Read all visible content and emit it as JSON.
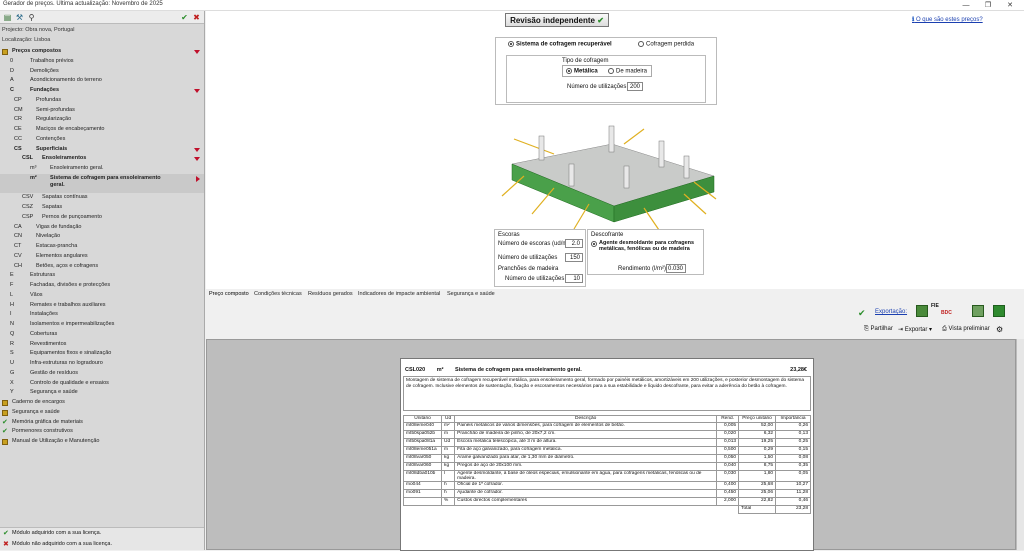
{
  "window": {
    "title": "Gerador de preços. Última actualização: Novembro de 2025",
    "min": "—",
    "max": "❐",
    "close": "✕"
  },
  "project": {
    "line1": "Projecto: Obra nova, Portugal",
    "line2": "Localização: Lisboa"
  },
  "tree": [
    {
      "code": "",
      "label": "Preços compostos",
      "bold": true,
      "indent": 0,
      "marker": "down",
      "dot": true
    },
    {
      "code": "0",
      "label": "Trabalhos prévios",
      "indent": 1
    },
    {
      "code": "D",
      "label": "Demolições",
      "indent": 1
    },
    {
      "code": "A",
      "label": "Acondicionamento do terreno",
      "indent": 1
    },
    {
      "code": "C",
      "label": "Fundações",
      "bold": true,
      "indent": 1,
      "marker": "down"
    },
    {
      "code": "CP",
      "label": "Profundas",
      "indent": 2
    },
    {
      "code": "CM",
      "label": "Semi-profundas",
      "indent": 2
    },
    {
      "code": "CR",
      "label": "Regularização",
      "indent": 2
    },
    {
      "code": "CE",
      "label": "Maciços de encabeçamento",
      "indent": 2
    },
    {
      "code": "CC",
      "label": "Contenções",
      "indent": 2
    },
    {
      "code": "CS",
      "label": "Superficiais",
      "bold": true,
      "indent": 2,
      "marker": "down"
    },
    {
      "code": "CSL",
      "label": "Ensoleiramentos",
      "bold": true,
      "indent": 3,
      "marker": "down"
    },
    {
      "code": "m³",
      "label": "Ensoleiramento geral.",
      "indent": 4
    },
    {
      "code": "m²",
      "label": "Sistema de cofragem para ensoleiramento geral.",
      "bold": true,
      "indent": 4,
      "marker": "right",
      "sel": true,
      "twoline": true
    },
    {
      "code": "CSV",
      "label": "Sapatas contínuas",
      "indent": 3
    },
    {
      "code": "CSZ",
      "label": "Sapatas",
      "indent": 3
    },
    {
      "code": "CSP",
      "label": "Pernos de punçoamento",
      "indent": 3
    },
    {
      "code": "CA",
      "label": "Vigas de fundação",
      "indent": 2
    },
    {
      "code": "CN",
      "label": "Nivelação",
      "indent": 2
    },
    {
      "code": "CT",
      "label": "Estacas-prancha",
      "indent": 2
    },
    {
      "code": "CV",
      "label": "Elementos angulares",
      "indent": 2
    },
    {
      "code": "CH",
      "label": "Betões, aços e cofragens",
      "indent": 2
    },
    {
      "code": "E",
      "label": "Estruturas",
      "indent": 1
    },
    {
      "code": "F",
      "label": "Fachadas, divisões e protecções",
      "indent": 1
    },
    {
      "code": "L",
      "label": "Vãos",
      "indent": 1
    },
    {
      "code": "H",
      "label": "Remates e trabalhos auxiliares",
      "indent": 1
    },
    {
      "code": "I",
      "label": "Instalações",
      "indent": 1
    },
    {
      "code": "N",
      "label": "Isolamentos e impermeabilizações",
      "indent": 1
    },
    {
      "code": "Q",
      "label": "Coberturas",
      "indent": 1
    },
    {
      "code": "R",
      "label": "Revestimentos",
      "indent": 1
    },
    {
      "code": "S",
      "label": "Equipamentos fixos e sinalização",
      "indent": 1
    },
    {
      "code": "U",
      "label": "Infra-estruturas no logradouro",
      "indent": 1
    },
    {
      "code": "G",
      "label": "Gestão de resíduos",
      "indent": 1
    },
    {
      "code": "X",
      "label": "Controlo de qualidade e ensaios",
      "indent": 1
    },
    {
      "code": "Y",
      "label": "Segurança e saúde",
      "indent": 1
    },
    {
      "code": "",
      "label": "Caderno de encargos",
      "indent": 0,
      "dot": true
    },
    {
      "code": "",
      "label": "Segurança e saúde",
      "indent": 0,
      "dot": true
    },
    {
      "code": "",
      "label": "Memória gráfica de materiais",
      "indent": 0,
      "check": true
    },
    {
      "code": "",
      "label": "Pormenores construtivos",
      "indent": 0,
      "check": true
    },
    {
      "code": "",
      "label": "Manual de Utilização e Manutenção",
      "indent": 0,
      "dot": true
    }
  ],
  "footer": {
    "licensed": "Módulo adquirido com a sua licença.",
    "notlicensed": "Módulo não adquirido com a sua licença."
  },
  "main": {
    "review_button": "Revisão independente",
    "what_link": "O que são estes preços?",
    "formwork": {
      "recup": "Sistema de cofragem recuperável",
      "lost": "Cofragem perdida",
      "type_title": "Tipo de cofragem",
      "metal": "Metálica",
      "wood": "De madeira",
      "uses_label": "Número de utilizações",
      "uses_value": "200"
    },
    "escoras": {
      "title": "Escoras",
      "num_label": "Número de escoras (ud/m²)",
      "num_value": "2.0",
      "uses_label": "Número de utilizações",
      "uses_value": "150"
    },
    "pranchoes": {
      "title": "Pranchões de madeira",
      "uses_label": "Número de utilizações",
      "uses_value": "10"
    },
    "descofrante": {
      "title": "Descofrante",
      "option": "Agente desmoldante para cofragens metálicas, fenólicas ou de madeira",
      "rend_label": "Rendimento (l/m²)",
      "rend_value": "0.030"
    }
  },
  "tabs": [
    "Preço composto",
    "Condições técnicas",
    "Resíduos gerados",
    "Indicadores de impacte ambiental",
    "Segurança e saúde"
  ],
  "export": {
    "label": "Exportação:",
    "share": "Partilhar",
    "export": "Exportar",
    "preview": "Vista preliminar",
    "fie": "FIE",
    "bdc": "BDC"
  },
  "report": {
    "code": "CSL020",
    "unit": "m²",
    "title": "Sistema de cofragem para ensoleiramento geral.",
    "price": "23,28€",
    "description": "Montagem de sistema de cofragem recuperável metálica, para ensoleiramento geral, formado por painéis metálicos, amortizáveis em 200 utilizações, e posterior desmontagem do sistema de cofragem. Inclusive elementos de sustentação, fixação e escoramentos necessários para a sua estabilidade e líquido descofrante, para evitar a aderência do betão à cofragem.",
    "headers": [
      "Unitário",
      "Ud",
      "Descrição",
      "Rend.",
      "Preço unitário",
      "Importância"
    ],
    "rows": [
      [
        "mt08eme040",
        "m²",
        "Painéis metálicos de vários dimensões, para cofragem de elementos de betão.",
        "0,005",
        "52,00",
        "0,26"
      ],
      [
        "mt50spa052b",
        "m",
        "Pranchão de madeira de pinho, de 20x7,2 cm.",
        "0,020",
        "6,32",
        "0,13"
      ],
      [
        "mt50spa081a",
        "Ud",
        "Escora metálica telescópica, até 3 m de altura.",
        "0,013",
        "19,25",
        "0,25"
      ],
      [
        "mt08eme051a",
        "m",
        "Fita de aço galvanizado, para cofragem metálica.",
        "0,500",
        "0,29",
        "0,15"
      ],
      [
        "mt08var050",
        "kg",
        "Arame galvanizado para atar, de 1,30 mm de diâmetro.",
        "0,050",
        "1,50",
        "0,08"
      ],
      [
        "mt08var060",
        "kg",
        "Pregos de aço de 20x100 mm.",
        "0,040",
        "8,75",
        "0,35"
      ],
      [
        "mt08dba010b",
        "l",
        "Agente desmoldante, à base de óleos especiais, emulsionante em água, para cofragens metálicas, fenólicas ou de madeira.",
        "0,030",
        "1,80",
        "0,05"
      ],
      [
        "mo044",
        "h",
        "Oficial de 1ª cofrador.",
        "0,400",
        "25,68",
        "10,27"
      ],
      [
        "mo091",
        "h",
        "Ajudante de cofrador.",
        "0,450",
        "25,06",
        "11,28"
      ],
      [
        "",
        "%",
        "Custos directos complementares",
        "2,000",
        "22,82",
        "0,46"
      ]
    ],
    "total_label": "Total",
    "total": "23,28"
  }
}
